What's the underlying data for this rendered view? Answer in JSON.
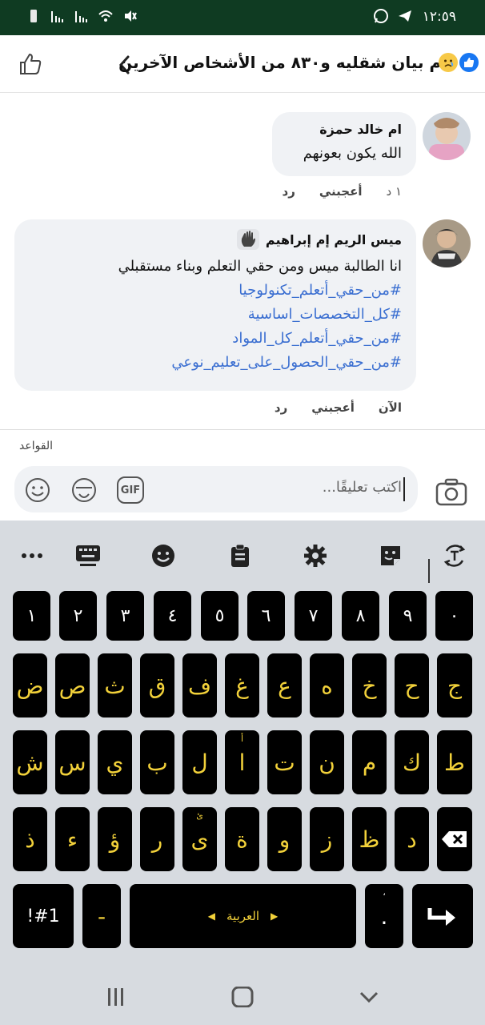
{
  "status_bar": {
    "time": "١٢:٥٩",
    "icons_right": [
      "telegram-icon",
      "whatsapp-icon"
    ],
    "icons_left": [
      "battery-icon",
      "signal-icon",
      "signal-icon-2",
      "wifi-icon",
      "mute-icon"
    ]
  },
  "header": {
    "title": "ام بيان شقليه و٨٣٠ من الأشخاص الآخرين",
    "reactions": [
      "like",
      "sad"
    ]
  },
  "comments": [
    {
      "author": "ام خالد حمزة",
      "lines": [
        "الله يكون بعونهم"
      ],
      "hashtags": [],
      "time": "١ د",
      "like_label": "أعجبني",
      "reply_label": "رد"
    },
    {
      "author": "ميس الريم إم إبراهيم",
      "lines": [
        "انا الطالبة ميس ومن حقي التعلم وبناء مستقبلي"
      ],
      "hashtags": [
        "#من_حقي_أتعلم_تكنولوجيا",
        "#كل_التخصصات_اساسية",
        "#من_حقي_أتعلم_كل_المواد",
        "#من_حقي_الحصول_على_تعليم_نوعي"
      ],
      "time": "الآن",
      "like_label": "أعجبني",
      "reply_label": "رد"
    }
  ],
  "rules_label": "القواعد",
  "composer": {
    "placeholder": "اكتب تعليقًا...",
    "tools": [
      "emoji-icon",
      "sticker-icon",
      "gif-icon"
    ],
    "gif_label": "GIF"
  },
  "keyboard": {
    "accent_color": "#f2d13a",
    "number_row": [
      "١",
      "٢",
      "٣",
      "٤",
      "٥",
      "٦",
      "٧",
      "٨",
      "٩",
      "٠"
    ],
    "row1": [
      "ض",
      "ص",
      "ث",
      "ق",
      "ف",
      "غ",
      "ع",
      "ه",
      "خ",
      "ح",
      "ج"
    ],
    "row2": [
      "ش",
      "س",
      "ي",
      "ب",
      "ل",
      "ا",
      "ت",
      "ن",
      "م",
      "ك",
      "ط"
    ],
    "row2_sub": "أ",
    "row3": [
      "ذ",
      "ء",
      "ؤ",
      "ر",
      "ى",
      "ة",
      "و",
      "ز",
      "ظ",
      "د"
    ],
    "row3_sub": "ئ",
    "symbols_label": "!#1",
    "dash_label": "-",
    "space_label": "العربية",
    "period_label": ".",
    "period_sub": "،"
  }
}
